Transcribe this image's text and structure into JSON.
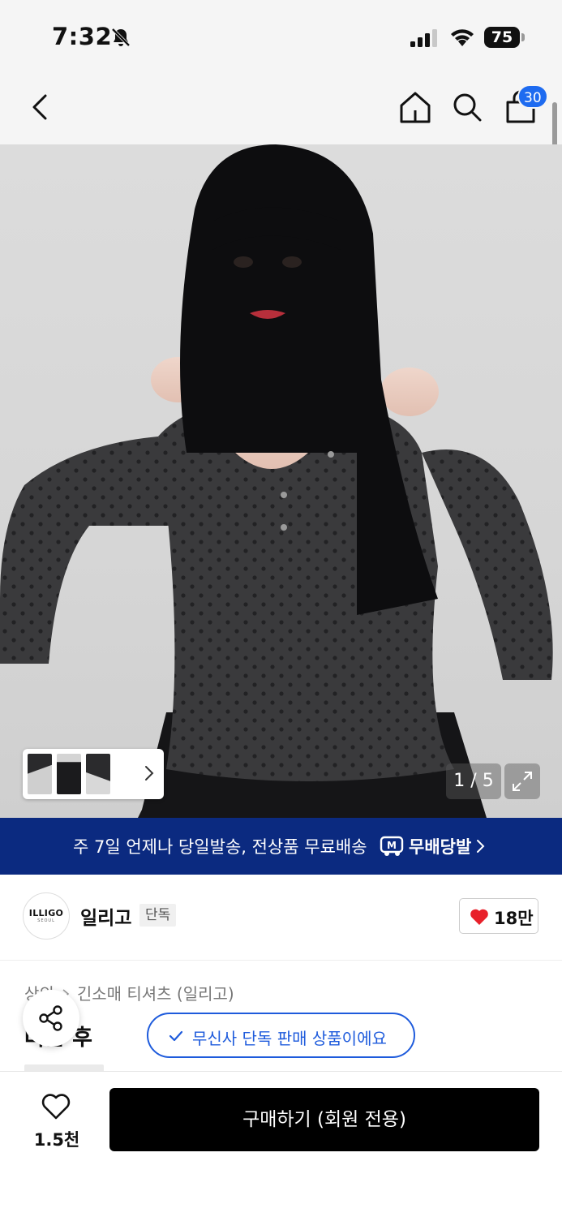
{
  "status_bar": {
    "time": "7:32",
    "battery": "75"
  },
  "header": {
    "cart_count": "30"
  },
  "gallery": {
    "page": "1 / 5",
    "thumbnails": [
      "thumb-1",
      "thumb-2",
      "thumb-3"
    ]
  },
  "promo": {
    "text": "주 7일 언제나 당일발송, 전상품 무료배송",
    "brand": "무배당발",
    "logo_letter": "M"
  },
  "brand": {
    "logo_text": "ILLIGO",
    "logo_sub": "SEOUL",
    "name": "일리고",
    "tag": "단독",
    "likes": "18만"
  },
  "product": {
    "breadcrumb": [
      "상의",
      "긴소매 티셔츠 (일리고)"
    ],
    "title": "버튼 후",
    "exclusive_notice": "무신사 단독 판매 상품이에요"
  },
  "bottom_bar": {
    "wish_count": "1.5천",
    "buy_label": "구매하기 (회원 전용)"
  },
  "colors": {
    "accent_blue": "#1e5bdc",
    "promo_navy": "#0b2a80",
    "badge_blue": "#1e6bf0",
    "heart_red": "#e8202a"
  },
  "icons": [
    "bell-off-icon",
    "signal-icon",
    "wifi-icon",
    "battery-icon",
    "back-icon",
    "home-icon",
    "search-icon",
    "cart-icon",
    "chevron-right-icon",
    "expand-icon",
    "heart-icon",
    "share-icon",
    "check-icon"
  ]
}
